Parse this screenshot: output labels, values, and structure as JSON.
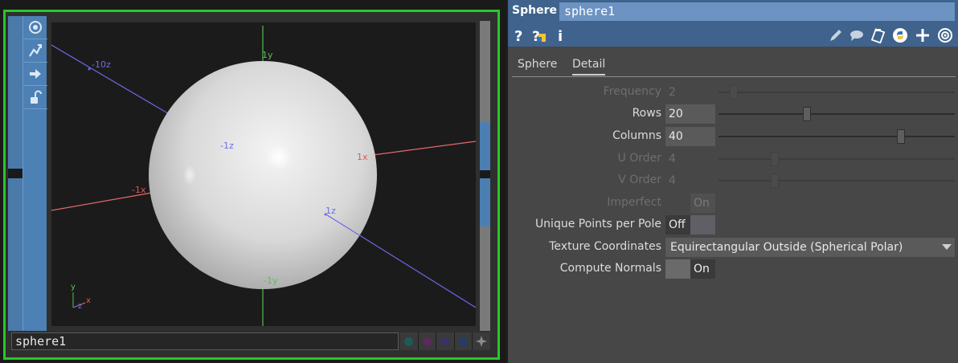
{
  "viewer": {
    "node_name": "sphere1",
    "axis_labels": {
      "neg10z": "-10z",
      "y1": "1y",
      "negz_inner": "-1z",
      "x1": "1x",
      "negx1": "-1x",
      "z1": "1z",
      "negy1": "-1y"
    },
    "gizmo": {
      "y": "y",
      "x": "x",
      "z": "z"
    },
    "tools": [
      "view-icon",
      "pose-icon",
      "arrow-icon",
      "lock-icon"
    ],
    "flags": [
      "cyan",
      "magenta",
      "purple",
      "blue",
      "star"
    ],
    "colors": {
      "frame": "#27c827",
      "x_axis": "#e05555",
      "y_axis": "#55c055",
      "z_axis": "#5555e0"
    }
  },
  "params": {
    "op_type": "Sphere",
    "op_name": "sphere1",
    "tabs": [
      "Sphere",
      "Detail"
    ],
    "active_tab": "Detail",
    "rows": {
      "frequency": {
        "label": "Frequency",
        "value": "2",
        "slider": 0.05,
        "disabled": true
      },
      "rows": {
        "label": "Rows",
        "value": "20",
        "slider": 0.37,
        "disabled": false
      },
      "columns": {
        "label": "Columns",
        "value": "40",
        "slider": 0.78,
        "disabled": false
      },
      "uorder": {
        "label": "U Order",
        "value": "4",
        "slider": 0.23,
        "disabled": true
      },
      "vorder": {
        "label": "V Order",
        "value": "4",
        "slider": 0.23,
        "disabled": true
      },
      "imperfect": {
        "label": "Imperfect",
        "value": "On",
        "disabled": true
      },
      "unique_points": {
        "label": "Unique Points per Pole",
        "value": "Off",
        "disabled": false
      },
      "texture_coords": {
        "label": "Texture Coordinates",
        "value": "Equirectangular Outside (Spherical Polar)",
        "disabled": false
      },
      "compute_normals": {
        "label": "Compute Normals",
        "value": "On",
        "disabled": false
      }
    }
  }
}
